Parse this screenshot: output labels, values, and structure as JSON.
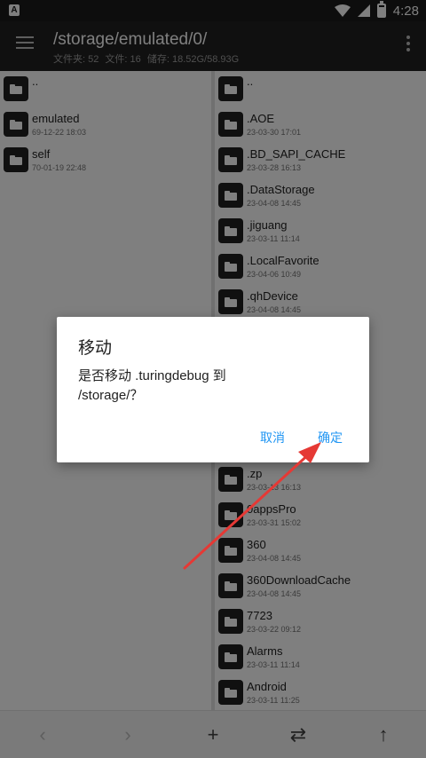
{
  "status_bar": {
    "app_badge": "A",
    "time": "4:28",
    "icons": [
      "wifi-icon",
      "signal-icon",
      "battery-icon"
    ]
  },
  "toolbar": {
    "menu_icon": "menu-icon",
    "path": "/storage/emulated/0/",
    "stats": {
      "folders": "文件夹: 52",
      "files": "文件: 16",
      "storage": "储存: 18.52G/58.93G"
    },
    "overflow_icon": "more-vert-icon"
  },
  "left_pane": {
    "items": [
      {
        "name": "..",
        "date": ""
      },
      {
        "name": "emulated",
        "date": "69-12-22 18:03"
      },
      {
        "name": "self",
        "date": "70-01-19 22:48"
      }
    ]
  },
  "right_pane": {
    "items": [
      {
        "name": "..",
        "date": ""
      },
      {
        "name": ".AOE",
        "date": "23-03-30 17:01"
      },
      {
        "name": ".BD_SAPI_CACHE",
        "date": "23-03-28 16:13"
      },
      {
        "name": ".DataStorage",
        "date": "23-04-08 14:45"
      },
      {
        "name": ".jiguang",
        "date": "23-03-11 11:14"
      },
      {
        "name": ".LocalFavorite",
        "date": "23-04-06 10:49"
      },
      {
        "name": ".qhDevice",
        "date": "23-04-08 14:45"
      },
      {
        "name": "",
        "date": ""
      },
      {
        "name": "",
        "date": ""
      },
      {
        "name": "",
        "date": ""
      },
      {
        "name": "",
        "date": ""
      },
      {
        "name": ".zp",
        "date": "23-03-13 16:13"
      },
      {
        "name": "0appsPro",
        "date": "23-03-31 15:02"
      },
      {
        "name": "360",
        "date": "23-04-08 14:45"
      },
      {
        "name": "360DownloadCache",
        "date": "23-04-08 14:45"
      },
      {
        "name": "7723",
        "date": "23-03-22 09:12"
      },
      {
        "name": "Alarms",
        "date": "23-03-11 11:14"
      },
      {
        "name": "Android",
        "date": "23-03-11 11:25"
      }
    ]
  },
  "bottom_bar": {
    "back": "‹",
    "forward": "›",
    "add": "+",
    "swap": "⇄",
    "up": "↑"
  },
  "dialog": {
    "title": "移动",
    "message": "是否移动 .turingdebug 到 /storage/？",
    "cancel_label": "取消",
    "ok_label": "确定",
    "button_color": "#2196f3"
  },
  "annotation": {
    "arrow_color": "#e53935"
  }
}
